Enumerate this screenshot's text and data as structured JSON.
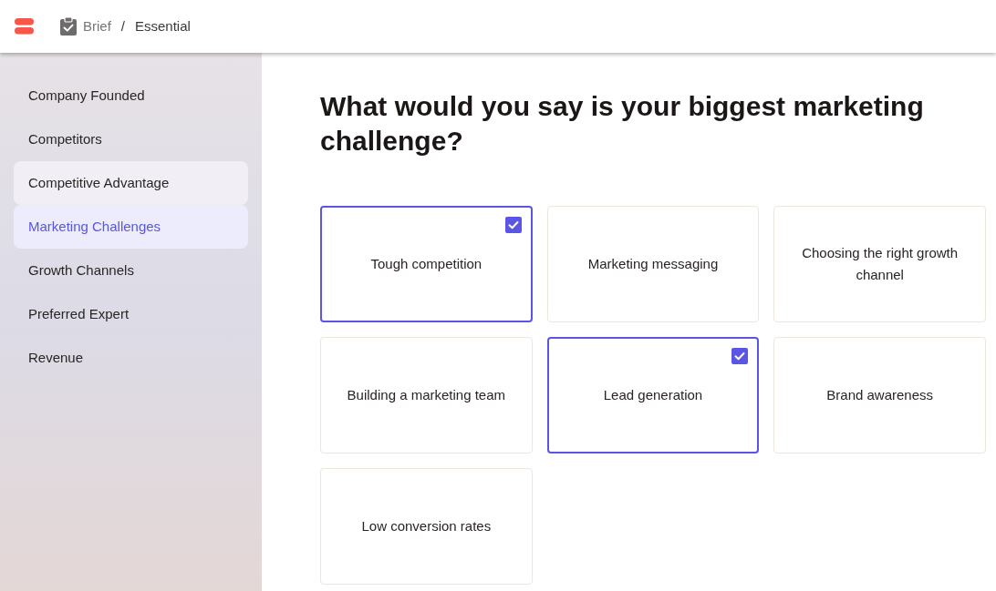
{
  "header": {
    "breadcrumb": [
      {
        "label": "Brief",
        "current": false
      },
      {
        "label": "Essential",
        "current": true
      }
    ],
    "separator": "/"
  },
  "sidebar": {
    "items": [
      {
        "label": "Company Founded",
        "selected": false,
        "hovered": false
      },
      {
        "label": "Competitors",
        "selected": false,
        "hovered": false
      },
      {
        "label": "Competitive Advantage",
        "selected": false,
        "hovered": true
      },
      {
        "label": "Marketing Challenges",
        "selected": true,
        "hovered": false
      },
      {
        "label": "Growth Channels",
        "selected": false,
        "hovered": false
      },
      {
        "label": "Preferred Expert",
        "selected": false,
        "hovered": false
      },
      {
        "label": "Revenue",
        "selected": false,
        "hovered": false
      }
    ]
  },
  "question": {
    "title": "What would you say is your biggest marketing challenge?",
    "options": [
      {
        "label": "Tough competition",
        "checked": true
      },
      {
        "label": "Marketing messaging",
        "checked": false
      },
      {
        "label": "Choosing the right growth channel",
        "checked": false
      },
      {
        "label": "Building a marketing team",
        "checked": false
      },
      {
        "label": "Lead generation",
        "checked": true
      },
      {
        "label": "Brand awareness",
        "checked": false
      },
      {
        "label": "Low conversion rates",
        "checked": false
      }
    ]
  }
}
